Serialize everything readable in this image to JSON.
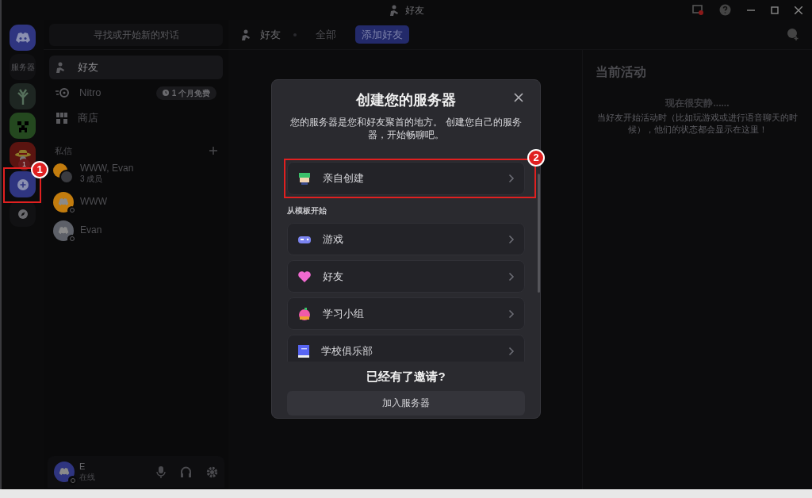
{
  "window": {
    "title": "好友"
  },
  "servers": [
    {
      "kind": "home",
      "selected": true
    },
    {
      "kind": "folder",
      "label": "服务器"
    },
    {
      "kind": "tree"
    },
    {
      "kind": "creeper"
    },
    {
      "kind": "pirate",
      "badge": "1"
    },
    {
      "kind": "add"
    },
    {
      "kind": "explore"
    }
  ],
  "sidebar": {
    "search": "寻找或开始新的对话",
    "items": [
      {
        "kind": "friends",
        "label": "好友",
        "selected": true
      },
      {
        "kind": "nitro",
        "label": "Nitro",
        "badge": "1 个月免费",
        "selected": false
      },
      {
        "kind": "shop",
        "label": "商店",
        "selected": false
      }
    ],
    "dm_header": "私信",
    "dms": [
      {
        "name": "WWW, Evan",
        "subtitle": "3 成员",
        "kind": "group",
        "color": "#c27c0e"
      },
      {
        "name": "WWW",
        "kind": "single",
        "color": "#c27c0e"
      },
      {
        "name": "Evan",
        "kind": "single",
        "color": "#5d6068"
      }
    ]
  },
  "user": {
    "name": "E",
    "status": "在线"
  },
  "toolbar": {
    "title": "好友",
    "tabs": [
      {
        "label": "全部",
        "selected": false
      },
      {
        "label": "添加好友",
        "selected": true
      }
    ]
  },
  "activity": {
    "title": "当前活动",
    "empty_title": "现在很安静......",
    "empty_text": "当好友开始活动时（比如玩游戏或进行语音聊天的时候），他们的状态都会显示在这里！"
  },
  "modal": {
    "title": "创建您的服务器",
    "description": "您的服务器是您和好友聚首的地方。 创建您自己的服务器，开始畅聊吧。",
    "create": {
      "label": "亲自创建",
      "kind": "create"
    },
    "section": "从模板开始",
    "templates": [
      {
        "label": "游戏",
        "kind": "game"
      },
      {
        "label": "好友",
        "kind": "heart"
      },
      {
        "label": "学习小组",
        "kind": "apple"
      },
      {
        "label": "学校俱乐部",
        "kind": "book"
      }
    ],
    "footer_title": "已经有了邀请?",
    "join": "加入服务器"
  },
  "annotations": [
    {
      "number": "1"
    },
    {
      "number": "2"
    }
  ]
}
